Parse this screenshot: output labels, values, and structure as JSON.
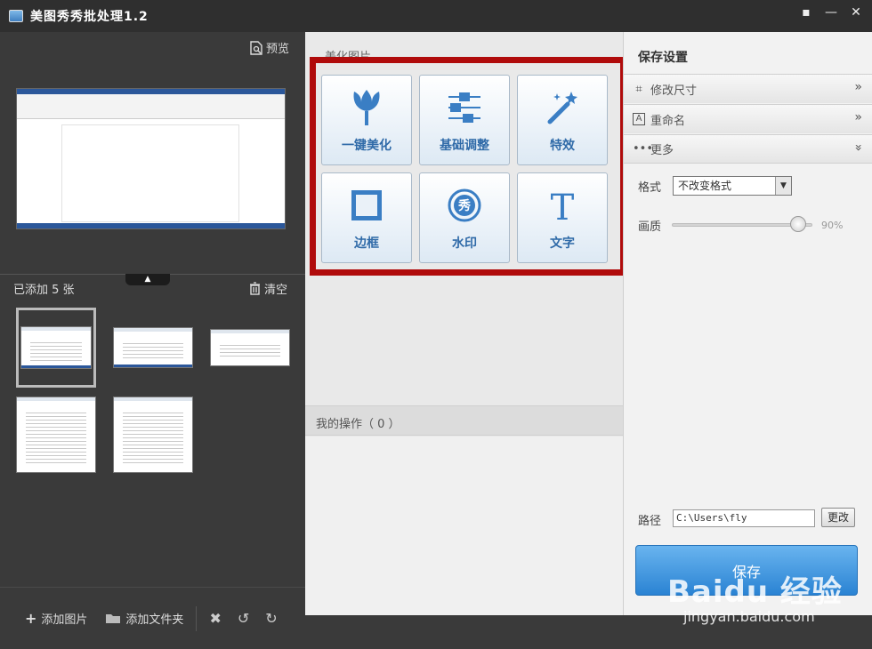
{
  "window": {
    "title": "美图秀秀批处理1.2"
  },
  "left": {
    "preview_label": "预览",
    "added_label": "已添加 5 张",
    "clear_label": "清空",
    "toolbar": {
      "add_image": "添加图片",
      "add_folder": "添加文件夹"
    }
  },
  "middle": {
    "section_title": "美化图片",
    "tiles": [
      {
        "label": "一键美化",
        "icon": "tulip-icon"
      },
      {
        "label": "基础调整",
        "icon": "sliders-icon"
      },
      {
        "label": "特效",
        "icon": "magic-wand-icon"
      },
      {
        "label": "边框",
        "icon": "frame-icon"
      },
      {
        "label": "水印",
        "icon": "watermark-icon"
      },
      {
        "label": "文字",
        "icon": "text-icon"
      }
    ],
    "my_ops_label": "我的操作（ 0 ）"
  },
  "right": {
    "title": "保存设置",
    "resize_label": "修改尺寸",
    "rename_label": "重命名",
    "more_label": "更多",
    "format_label": "格式",
    "format_value": "不改变格式",
    "quality_label": "画质",
    "quality_value": "90%",
    "quality_fraction": 0.9,
    "path_label": "路径",
    "path_value": "C:\\Users\\fly",
    "change_label": "更改",
    "save_label": "保存"
  },
  "watermark": {
    "brand": "Baidu 经验",
    "url": "jingyan.baidu.com"
  },
  "colors": {
    "highlight": "#b00b0b",
    "accent": "#2f6aa8",
    "save_button": "#2a83d3"
  }
}
